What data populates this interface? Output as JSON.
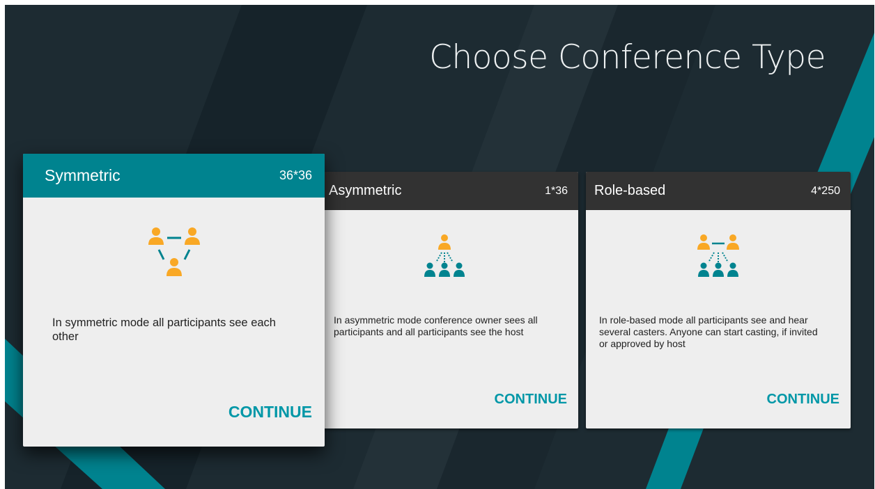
{
  "page": {
    "title": "Choose Conference Type"
  },
  "colors": {
    "background": "#1d2b32",
    "accent_stripe": "#00838f",
    "selected_header": "#00838f",
    "card_header": "#323232",
    "card_body": "#eeeeee",
    "continue_text": "#0097a7",
    "person_orange": "#f9a825",
    "person_teal": "#00838f"
  },
  "cards": [
    {
      "id": "symmetric",
      "title": "Symmetric",
      "count": "36*36",
      "icon": "triangle-participants-icon",
      "description": "In symmetric mode all participants see each other",
      "action": "CONTINUE",
      "selected": true
    },
    {
      "id": "asymmetric",
      "title": "Asymmetric",
      "count": "1*36",
      "icon": "host-to-participants-icon",
      "description": "In asymmetric mode conference owner sees all participants and all participants see the host",
      "action": "CONTINUE",
      "selected": false
    },
    {
      "id": "role-based",
      "title": "Role-based",
      "count": "4*250",
      "icon": "casters-to-participants-icon",
      "description": "In role-based mode all participants see and hear several casters. Anyone can start casting, if invited or approved by host",
      "action": "CONTINUE",
      "selected": false
    }
  ]
}
